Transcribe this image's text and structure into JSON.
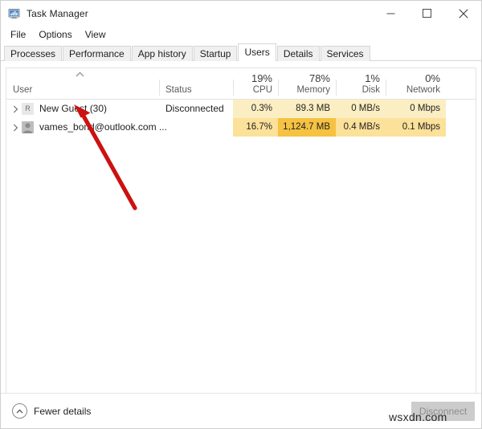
{
  "window": {
    "title": "Task Manager",
    "icon": "task-manager-icon",
    "controls": {
      "minimize": "minimize-icon",
      "maximize": "maximize-icon",
      "close": "close-icon"
    }
  },
  "menubar": {
    "items": [
      {
        "label": "File"
      },
      {
        "label": "Options"
      },
      {
        "label": "View"
      }
    ]
  },
  "tabs": [
    {
      "label": "Processes",
      "active": false
    },
    {
      "label": "Performance",
      "active": false
    },
    {
      "label": "App history",
      "active": false
    },
    {
      "label": "Startup",
      "active": false
    },
    {
      "label": "Users",
      "active": true
    },
    {
      "label": "Details",
      "active": false
    },
    {
      "label": "Services",
      "active": false
    }
  ],
  "table": {
    "sort": {
      "column": "User",
      "direction": "ascending",
      "icon": "sort-ascending-icon"
    },
    "columns": [
      {
        "key": "user",
        "name": "User",
        "percent": ""
      },
      {
        "key": "status",
        "name": "Status",
        "percent": ""
      },
      {
        "key": "cpu",
        "name": "CPU",
        "percent": "19%"
      },
      {
        "key": "memory",
        "name": "Memory",
        "percent": "78%"
      },
      {
        "key": "disk",
        "name": "Disk",
        "percent": "1%"
      },
      {
        "key": "network",
        "name": "Network",
        "percent": "0%"
      }
    ],
    "rows": [
      {
        "expander": "chevron-right-icon",
        "avatar": "default-user-avatar",
        "avatar_letter": "R",
        "user": "New Guest (30)",
        "status": "Disconnected",
        "cpu": "0.3%",
        "memory": "89.3 MB",
        "disk": "0 MB/s",
        "network": "0 Mbps",
        "heat": {
          "cpu": "#fbeec2",
          "memory": "#fbeec2",
          "disk": "#fbeec2",
          "network": "#fbeec2"
        }
      },
      {
        "expander": "chevron-right-icon",
        "avatar": "photo-user-avatar",
        "avatar_letter": "",
        "user": "vames_bond@outlook.com ...",
        "status": "",
        "cpu": "16.7%",
        "memory": "1,124.7 MB",
        "disk": "0.4 MB/s",
        "network": "0.1 Mbps",
        "heat": {
          "cpu": "#fbe19a",
          "memory": "#f5c242",
          "disk": "#fbe19a",
          "network": "#fbe19a"
        }
      }
    ]
  },
  "footer": {
    "fewer_details": "Fewer details",
    "fewer_details_icon": "chevron-up-circle-icon",
    "disconnect_label": "Disconnect",
    "disconnect_enabled": false
  },
  "annotation": {
    "arrow": "red-arrow-annotation",
    "color": "#cc1111"
  },
  "watermark": {
    "text": "wsxdn.com"
  }
}
